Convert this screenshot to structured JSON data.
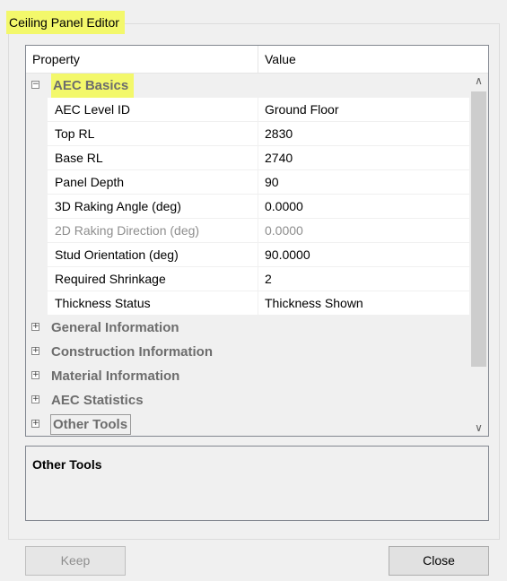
{
  "panel": {
    "title": "Ceiling Panel Editor"
  },
  "grid": {
    "headers": {
      "property": "Property",
      "value": "Value"
    },
    "categories": [
      {
        "label": "AEC Basics",
        "expanded": true,
        "highlighted": true,
        "properties": [
          {
            "name": "AEC Level ID",
            "value": "Ground Floor",
            "disabled": false
          },
          {
            "name": "Top RL",
            "value": "2830",
            "disabled": false
          },
          {
            "name": "Base RL",
            "value": "2740",
            "disabled": false
          },
          {
            "name": "Panel Depth",
            "value": "90",
            "disabled": false
          },
          {
            "name": "3D Raking Angle (deg)",
            "value": "0.0000",
            "disabled": false
          },
          {
            "name": "2D Raking Direction (deg)",
            "value": "0.0000",
            "disabled": true
          },
          {
            "name": "Stud Orientation (deg)",
            "value": "90.0000",
            "disabled": false
          },
          {
            "name": "Required Shrinkage",
            "value": "2",
            "disabled": false
          },
          {
            "name": "Thickness Status",
            "value": "Thickness Shown",
            "disabled": false
          }
        ]
      },
      {
        "label": "General Information",
        "expanded": false
      },
      {
        "label": "Construction Information",
        "expanded": false
      },
      {
        "label": "Material Information",
        "expanded": false
      },
      {
        "label": "AEC Statistics",
        "expanded": false
      },
      {
        "label": "Other Tools",
        "expanded": false,
        "focused": true
      }
    ],
    "expander_symbols": {
      "collapse": "⊟",
      "expand": "⊞"
    }
  },
  "description": {
    "title": "Other Tools"
  },
  "buttons": {
    "keep": "Keep",
    "close": "Close"
  },
  "colors": {
    "highlight": "#f3f86b",
    "category_text": "#6d6d6d",
    "disabled_text": "#8e8e8e"
  }
}
